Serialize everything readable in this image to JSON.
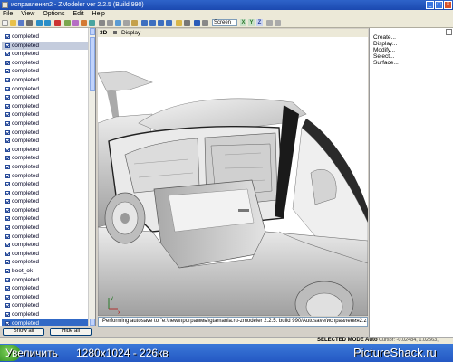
{
  "window": {
    "title": "исправления2 - ZModeler ver 2.2.5 (Build 990)"
  },
  "menu": [
    "File",
    "View",
    "Options",
    "Edit",
    "Help"
  ],
  "toolbar": {
    "screen_combo": "Screen",
    "axes": [
      "X",
      "Y",
      "Z"
    ]
  },
  "left_panel": {
    "items": [
      {
        "label": "completed",
        "state": "normal"
      },
      {
        "label": "completed",
        "state": "selected-gray"
      },
      {
        "label": "completed",
        "state": "normal"
      },
      {
        "label": "completed",
        "state": "normal"
      },
      {
        "label": "completed",
        "state": "normal"
      },
      {
        "label": "completed",
        "state": "normal"
      },
      {
        "label": "completed",
        "state": "normal"
      },
      {
        "label": "completed",
        "state": "normal"
      },
      {
        "label": "completed",
        "state": "normal"
      },
      {
        "label": "completed",
        "state": "normal"
      },
      {
        "label": "completed",
        "state": "normal"
      },
      {
        "label": "completed",
        "state": "normal"
      },
      {
        "label": "completed",
        "state": "normal"
      },
      {
        "label": "completed",
        "state": "normal"
      },
      {
        "label": "completed",
        "state": "normal"
      },
      {
        "label": "completed",
        "state": "normal"
      },
      {
        "label": "completed",
        "state": "normal"
      },
      {
        "label": "completed",
        "state": "normal"
      },
      {
        "label": "completed",
        "state": "normal"
      },
      {
        "label": "completed",
        "state": "normal"
      },
      {
        "label": "completed",
        "state": "normal"
      },
      {
        "label": "completed",
        "state": "normal"
      },
      {
        "label": "completed",
        "state": "normal"
      },
      {
        "label": "completed",
        "state": "normal"
      },
      {
        "label": "completed",
        "state": "normal"
      },
      {
        "label": "completed",
        "state": "normal"
      },
      {
        "label": "completed",
        "state": "normal"
      },
      {
        "label": "boot_ok",
        "state": "normal"
      },
      {
        "label": "completed",
        "state": "normal"
      },
      {
        "label": "completed",
        "state": "normal"
      },
      {
        "label": "completed",
        "state": "normal"
      },
      {
        "label": "completed",
        "state": "normal"
      },
      {
        "label": "completed",
        "state": "normal"
      },
      {
        "label": "completed",
        "state": "selected"
      },
      {
        "label": "completed",
        "state": "normal"
      }
    ],
    "show_all": "Show all",
    "hide_all": "Hide all"
  },
  "viewport": {
    "mode": "3D",
    "label": "Display"
  },
  "right_panel": {
    "commands": [
      "Create...",
      "Display...",
      "Modify...",
      "Select...",
      "Surface..."
    ]
  },
  "status": {
    "message": "Performing autosave to \"e:\\new\\программы\\gtamania.ru-zmodeler 2.2.5. build 990/Autosave/исправления2.z3d\"",
    "mode": "SELECTED MODE",
    "auto": "Auto",
    "cursor": "Cursor: -0.02484, 1.02563, -0.611"
  },
  "overlay": {
    "zoom_label": "Увеличить",
    "resolution": "1280x1024 - 226кв",
    "watermark": "PictureShack.ru"
  },
  "colors": {
    "title_bar": "#2458c4",
    "selection": "#3169c6",
    "taskbar": "#2458c4",
    "start": "#2f8f20"
  }
}
